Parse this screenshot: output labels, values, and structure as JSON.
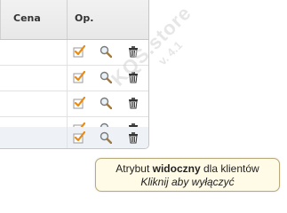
{
  "table": {
    "headers": {
      "price": "Cena",
      "operations": "Op."
    },
    "rows": [
      {
        "visible": true
      },
      {
        "visible": true
      },
      {
        "visible": true
      },
      {
        "visible": true
      },
      {
        "visible": true
      }
    ],
    "icons": {
      "checkbox": "checkbox-checked-icon",
      "search": "magnifier-icon",
      "delete": "trash-icon"
    }
  },
  "watermark": {
    "text": "KQS.store",
    "version": "v. 4.1"
  },
  "tooltip": {
    "prefix": "Atrybut ",
    "bold": "widoczny",
    "suffix": " dla klientów",
    "action": "Kliknij aby wyłączyć"
  },
  "colors": {
    "checkbox_check": "#e98a14",
    "header_bg": "#eeeeee",
    "tooltip_bg": "#fffbe6"
  }
}
